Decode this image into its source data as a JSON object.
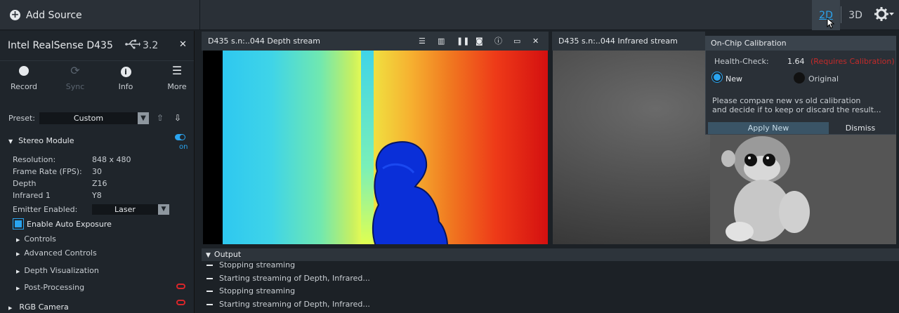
{
  "topbar": {
    "add_source_label": "Add Source",
    "view_2d_label": "2D",
    "view_3d_label": "3D",
    "gear_icon": "⚙▾"
  },
  "device": {
    "name": "Intel RealSense D435",
    "usb_version": "3.2",
    "tools": [
      {
        "label": "Record"
      },
      {
        "label": "Sync"
      },
      {
        "label": "Info"
      },
      {
        "label": "More"
      }
    ],
    "preset_label": "Preset:",
    "preset_value": "Custom",
    "stereo_module_label": "Stereo Module",
    "toggle_label": "on",
    "props": [
      {
        "key": "Resolution:",
        "value": "848 x 480"
      },
      {
        "key": "Frame Rate (FPS):",
        "value": "30"
      },
      {
        "key": "Depth",
        "value": "Z16"
      },
      {
        "key": "Infrared 1",
        "value": "Y8"
      }
    ],
    "emitter_label": "Emitter Enabled:",
    "emitter_value": "Laser",
    "auto_exposure_label": "Enable Auto Exposure",
    "tree": [
      "Controls",
      "Advanced Controls",
      "Depth Visualization",
      "Post-Processing"
    ],
    "rgb_camera_label": "RGB Camera"
  },
  "streams": {
    "depth_title": "D435 s.n:..044 Depth stream",
    "ir_title": "D435 s.n:..044 Infrared stream"
  },
  "calibration": {
    "title": "On-Chip Calibration",
    "health_label": "Health-Check:",
    "health_value": "1.64",
    "health_warning": "(Requires Calibration)",
    "new_label": "New",
    "original_label": "Original",
    "message_line1": "Please compare new vs old calibration",
    "message_line2": "and decide if to keep or discard the result...",
    "apply_label": "Apply New",
    "dismiss_label": "Dismiss"
  },
  "output": {
    "title": "Output",
    "lines": [
      "Stopping streaming",
      "Starting streaming of Depth, Infrared...",
      "Stopping streaming",
      "Starting streaming of Depth, Infrared..."
    ]
  },
  "colors": {
    "accent": "#2aa4ef",
    "warning": "#c42a2a"
  }
}
